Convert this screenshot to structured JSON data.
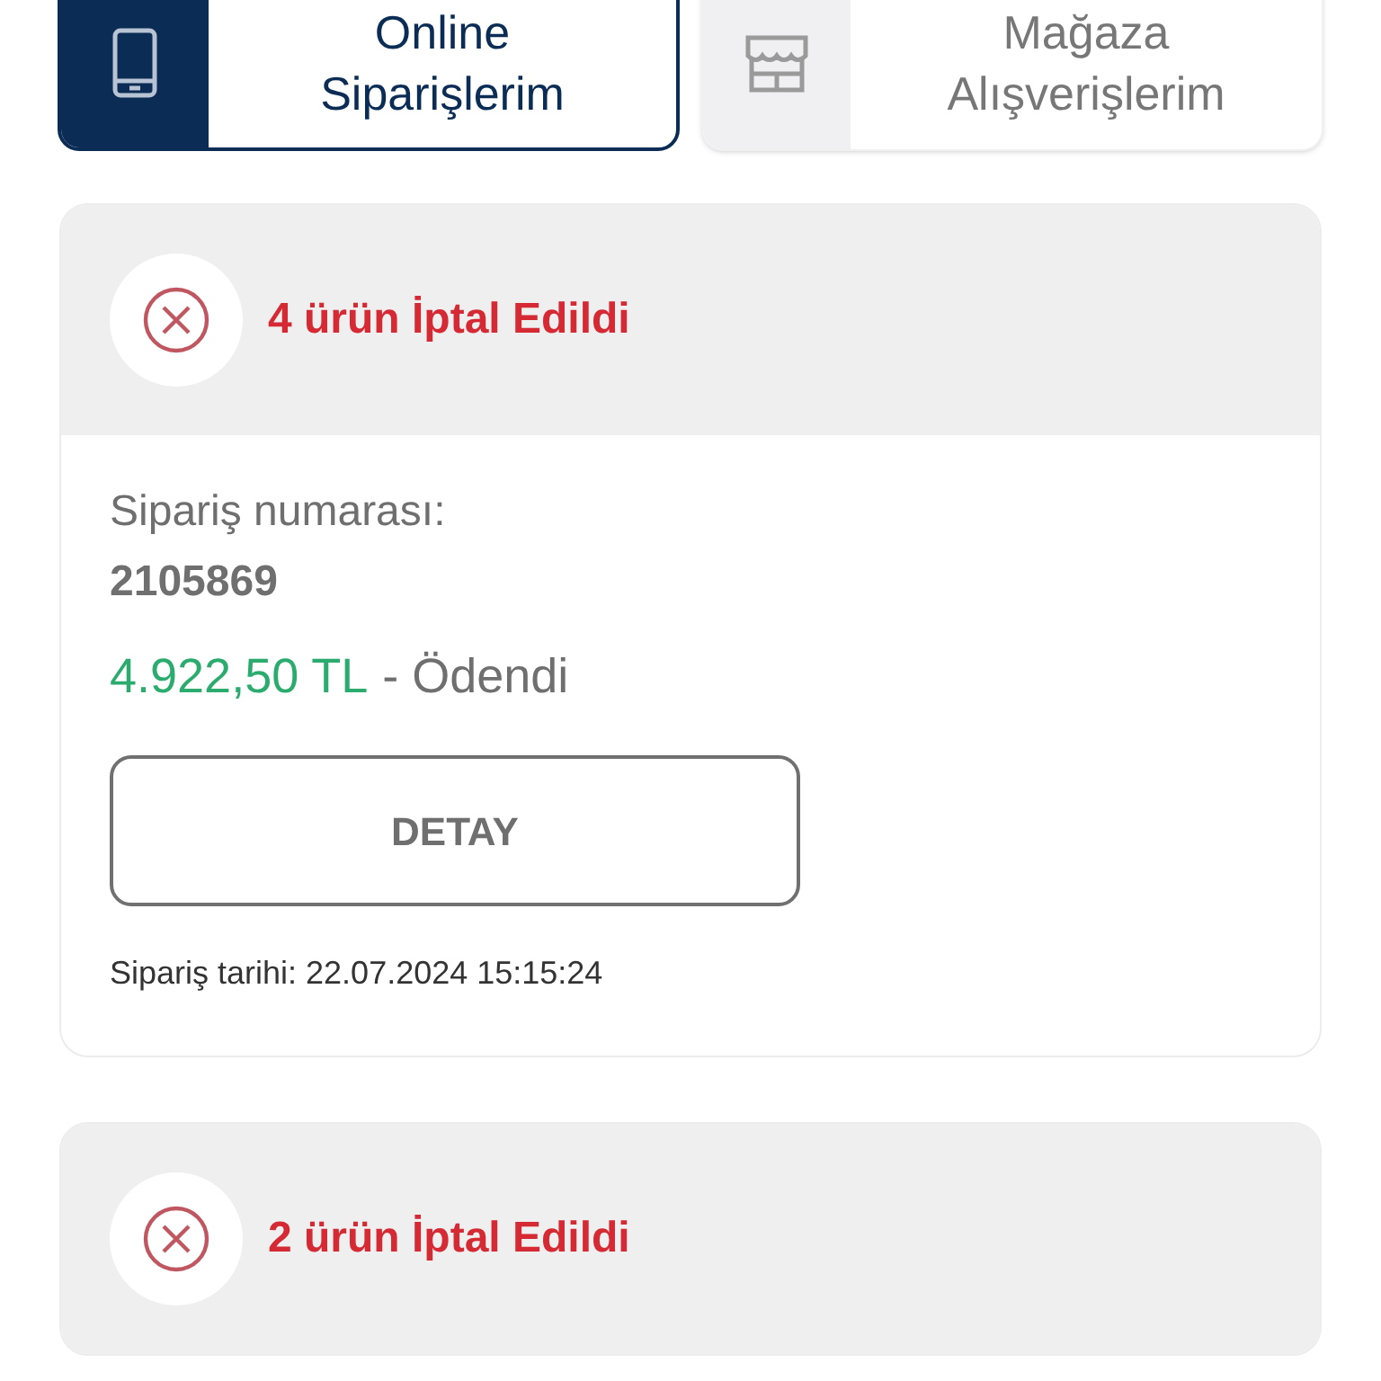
{
  "tabs": [
    {
      "label_line1": "Online",
      "label_line2": "Siparişlerim",
      "kind": "phone",
      "selected": true
    },
    {
      "label_line1": "Mağaza",
      "label_line2": "Alışverişlerim",
      "kind": "store",
      "selected": false
    }
  ],
  "orders": [
    {
      "status": "4 ürün İptal Edildi",
      "number_label": "Sipariş numarası:",
      "number": "2105869",
      "amount": "4.922,50 TL",
      "payment": "- Ödendi",
      "button": "DETAY",
      "date": "Sipariş tarihi: 22.07.2024 15:15:24"
    },
    {
      "status": "2 ürün İptal Edildi"
    }
  ]
}
